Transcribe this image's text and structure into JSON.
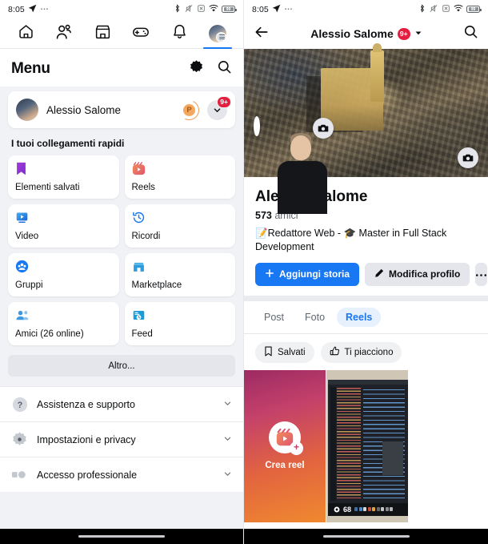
{
  "status_bar": {
    "time": "8:05",
    "battery_level": "99",
    "icons": [
      "location-arrow-icon",
      "ellipsis-icon",
      "bluetooth-icon",
      "mute-icon",
      "no-sim-icon",
      "wifi-icon",
      "battery-icon"
    ]
  },
  "left_screen": {
    "nav": {
      "items": [
        {
          "name": "home-icon",
          "label": "Home",
          "active": false
        },
        {
          "name": "friends-icon",
          "label": "Amici",
          "active": false
        },
        {
          "name": "marketplace-icon",
          "label": "Marketplace",
          "active": false
        },
        {
          "name": "gaming-icon",
          "label": "Giochi",
          "active": false
        },
        {
          "name": "notifications-icon",
          "label": "Notifiche",
          "active": false
        },
        {
          "name": "menu-avatar-icon",
          "label": "Menu",
          "active": true
        }
      ]
    },
    "header": {
      "title": "Menu",
      "settings_icon": "gear-icon",
      "search_icon": "search-icon"
    },
    "profile_row": {
      "name": "Alessio Salome",
      "professional_badge": "P",
      "notification_count": "9+",
      "chevron_icon": "chevron-down-icon"
    },
    "shortcuts_label": "I tuoi collegamenti rapidi",
    "shortcuts": [
      {
        "label": "Elementi salvati",
        "icon": "bookmark-icon",
        "color": "#a033d0"
      },
      {
        "label": "Reels",
        "icon": "reels-icon",
        "color": "#e8643f"
      },
      {
        "label": "Video",
        "icon": "video-icon",
        "color": "#1c7ed6"
      },
      {
        "label": "Ricordi",
        "icon": "clock-rewind-icon",
        "color": "#1877f2"
      },
      {
        "label": "Gruppi",
        "icon": "groups-icon",
        "color": "#1877f2"
      },
      {
        "label": "Marketplace",
        "icon": "marketplace-icon",
        "color": "#2d9cdb"
      },
      {
        "label": "Amici (26 online)",
        "icon": "friends-icon",
        "color": "#3b9ae1"
      },
      {
        "label": "Feed",
        "icon": "feed-icon",
        "color": "#1c9bd8"
      }
    ],
    "more_button": "Altro...",
    "accordion": [
      {
        "label": "Assistenza e supporto",
        "icon": "question-circle-icon",
        "chevron": "chevron-down-icon"
      },
      {
        "label": "Impostazioni e privacy",
        "icon": "gear-icon",
        "chevron": "chevron-down-icon"
      },
      {
        "label": "Accesso professionale",
        "icon": "professional-icon",
        "chevron": "chevron-down-icon"
      }
    ]
  },
  "right_screen": {
    "header": {
      "back_icon": "back-arrow-icon",
      "title": "Alessio Salome",
      "badge": "9+",
      "dropdown_icon": "chevron-down-icon",
      "search_icon": "search-icon"
    },
    "cover_photo_camera_icon": "camera-icon",
    "profile_photo_camera_icon": "camera-icon",
    "name": "Alessio Salome",
    "friends_count": "573",
    "friends_label": "amici",
    "bio": "📝Redattore Web - 🎓 Master in Full Stack Development",
    "buttons": {
      "add_story": "Aggiungi storia",
      "add_story_icon": "plus-icon",
      "edit_profile": "Modifica profilo",
      "edit_profile_icon": "pencil-icon",
      "more": "•••"
    },
    "tabs": [
      {
        "label": "Post",
        "active": false
      },
      {
        "label": "Foto",
        "active": false
      },
      {
        "label": "Reels",
        "active": true
      }
    ],
    "filter_chips": [
      {
        "label": "Salvati",
        "icon": "bookmark-outline-icon"
      },
      {
        "label": "Ti piacciono",
        "icon": "thumbs-up-icon"
      }
    ],
    "reels": [
      {
        "type": "create",
        "label": "Crea reel",
        "icon": "reels-plus-icon"
      },
      {
        "type": "video",
        "views": "68",
        "views_icon": "eye-icon"
      }
    ]
  },
  "colors": {
    "accent": "#1877f2",
    "badge_red": "#e41e3f",
    "bg_gray": "#f0f2f5",
    "chip_gray": "#e4e6eb",
    "text_primary": "#0b0d0f",
    "text_secondary": "#606770"
  }
}
